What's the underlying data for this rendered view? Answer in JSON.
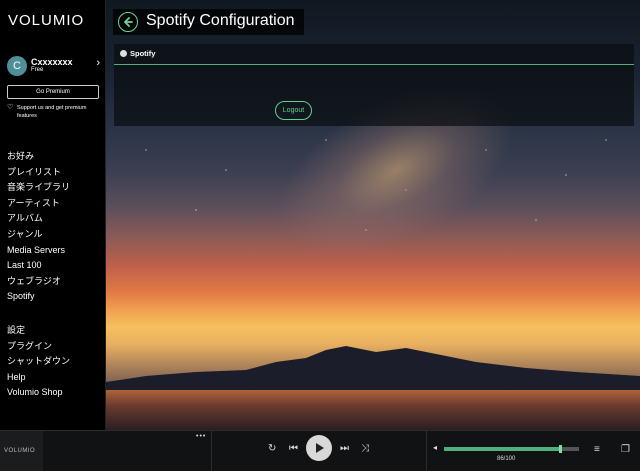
{
  "app": {
    "logo": "VOLUMIO"
  },
  "user": {
    "initial": "C",
    "name": "Cxxxxxxx",
    "plan": "Free"
  },
  "sidebar": {
    "premium_button": "Go Premium",
    "support_text": "Support us and get premium features",
    "nav_primary": [
      "お好み",
      "プレイリスト",
      "音楽ライブラリ",
      "アーティスト",
      "アルバム",
      "ジャンル",
      "Media Servers",
      "Last 100",
      "ウェブラジオ",
      "Spotify"
    ],
    "nav_secondary": [
      "設定",
      "プラグイン",
      "シャットダウン",
      "Help",
      "Volumio Shop"
    ]
  },
  "header": {
    "title": "Spotify Configuration"
  },
  "card": {
    "title": "Spotify",
    "logout_label": "Logout"
  },
  "player": {
    "thumb_label": "VOLUMIO",
    "more_label": "•••",
    "volume_text": "86/100",
    "volume_value": 86,
    "volume_max": 100
  },
  "icons": {
    "back": "arrow-left-icon",
    "repeat": "repeat-icon",
    "prev": "skip-previous-icon",
    "play": "play-icon",
    "next": "skip-next-icon",
    "shuffle": "shuffle-icon",
    "volume": "volume-icon",
    "queue": "queue-icon",
    "playlist": "playlist-icon"
  },
  "colors": {
    "accent": "#4fb07c",
    "accent_light": "#5fd08e",
    "sidebar_bg": "#000000",
    "player_bg": "#101214"
  }
}
